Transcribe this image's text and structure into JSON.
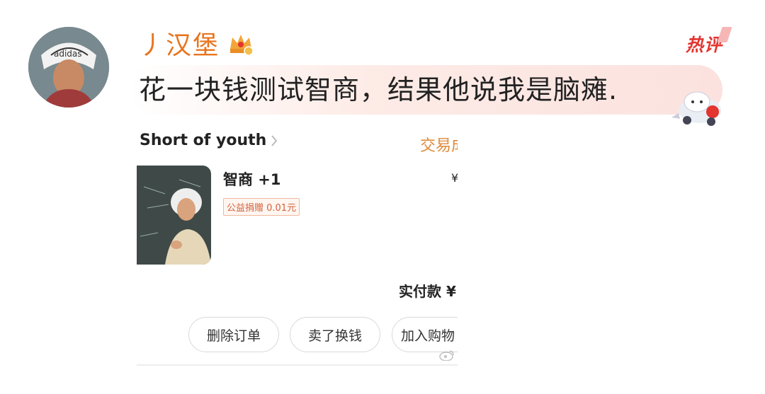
{
  "comment": {
    "username": "丿汉堡",
    "hot_badge": "热评",
    "text": "花一块钱测试智商，结果他说我是脑瘫."
  },
  "order": {
    "shop_name": "Short of youth",
    "trade_status": "交易成",
    "product": {
      "title": "智商 +1",
      "tag": "公益捐赠 0.01元",
      "price_prefix": "¥"
    },
    "paid_label": "实付款 ¥",
    "buttons": {
      "delete": "删除订单",
      "sell": "卖了换钱",
      "add_cart": "加入购物"
    }
  },
  "icons": {
    "avatar": "avatar-image",
    "crown": "crown-icon",
    "chevron": "chevron-right-icon",
    "mascot": "mascot-sticker",
    "watermark": "weibo-watermark-icon"
  },
  "colors": {
    "username": "#e8741e",
    "hot_badge": "#e3342f",
    "trade_status": "#e08a3a"
  }
}
